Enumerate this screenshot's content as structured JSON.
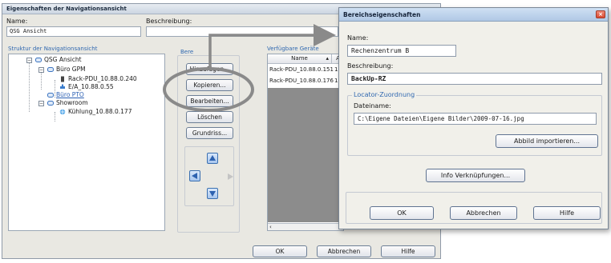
{
  "back_dialog": {
    "title": "Eigenschaften der Navigationsansicht",
    "name_label": "Name:",
    "name_value": "QSG Ansicht",
    "description_label": "Beschreibung:",
    "description_value": "",
    "structure_label": "Struktur der Navigationsansicht",
    "tree": {
      "root": "QSG Ansicht",
      "n1": "Büro GPM",
      "n1a": "Rack-PDU_10.88.0.240",
      "n1b": "E/A_10.88.0.55",
      "n2": "Büro PTO",
      "n3": "Showroom",
      "n3a": "Kühlung_10.88.0.177"
    },
    "area_label": "Bere",
    "buttons": {
      "add": "Hinzufügen...",
      "copy": "Kopieren...",
      "edit": "Bearbeiten...",
      "delete": "Löschen",
      "floorplan": "Grundriss..."
    },
    "devices_label": "Verfügbare Geräte",
    "devices_columns": [
      "Name",
      "A"
    ],
    "devices_rows": [
      {
        "name": "Rack-PDU_10.88.0.151",
        "extra": "1"
      },
      {
        "name": "Rack-PDU_10.88.0.176",
        "extra": "1"
      }
    ],
    "ok": "OK",
    "cancel": "Abbrechen",
    "help": "Hilfe"
  },
  "front_dialog": {
    "title": "Bereichseigenschaften",
    "name_label": "Name:",
    "name_value": "Rechenzentrum B",
    "description_label": "Beschreibung:",
    "description_value": "BackUp-RZ",
    "locator_group": "Locator-Zuordnung",
    "filename_label": "Dateiname:",
    "filename_value": "C:\\Eigene Dateien\\Eigene Bilder\\2009-07-16.jpg",
    "import_button": "Abbild importieren...",
    "links_button": "Info Verknüpfungen...",
    "ok": "OK",
    "cancel": "Abbrechen",
    "help": "Hilfe"
  },
  "colors": {
    "annotation_gray": "#8a8a8a",
    "title_bar": "#c3d6ee",
    "close_red": "#d94a32",
    "link_blue": "#3068b0"
  }
}
